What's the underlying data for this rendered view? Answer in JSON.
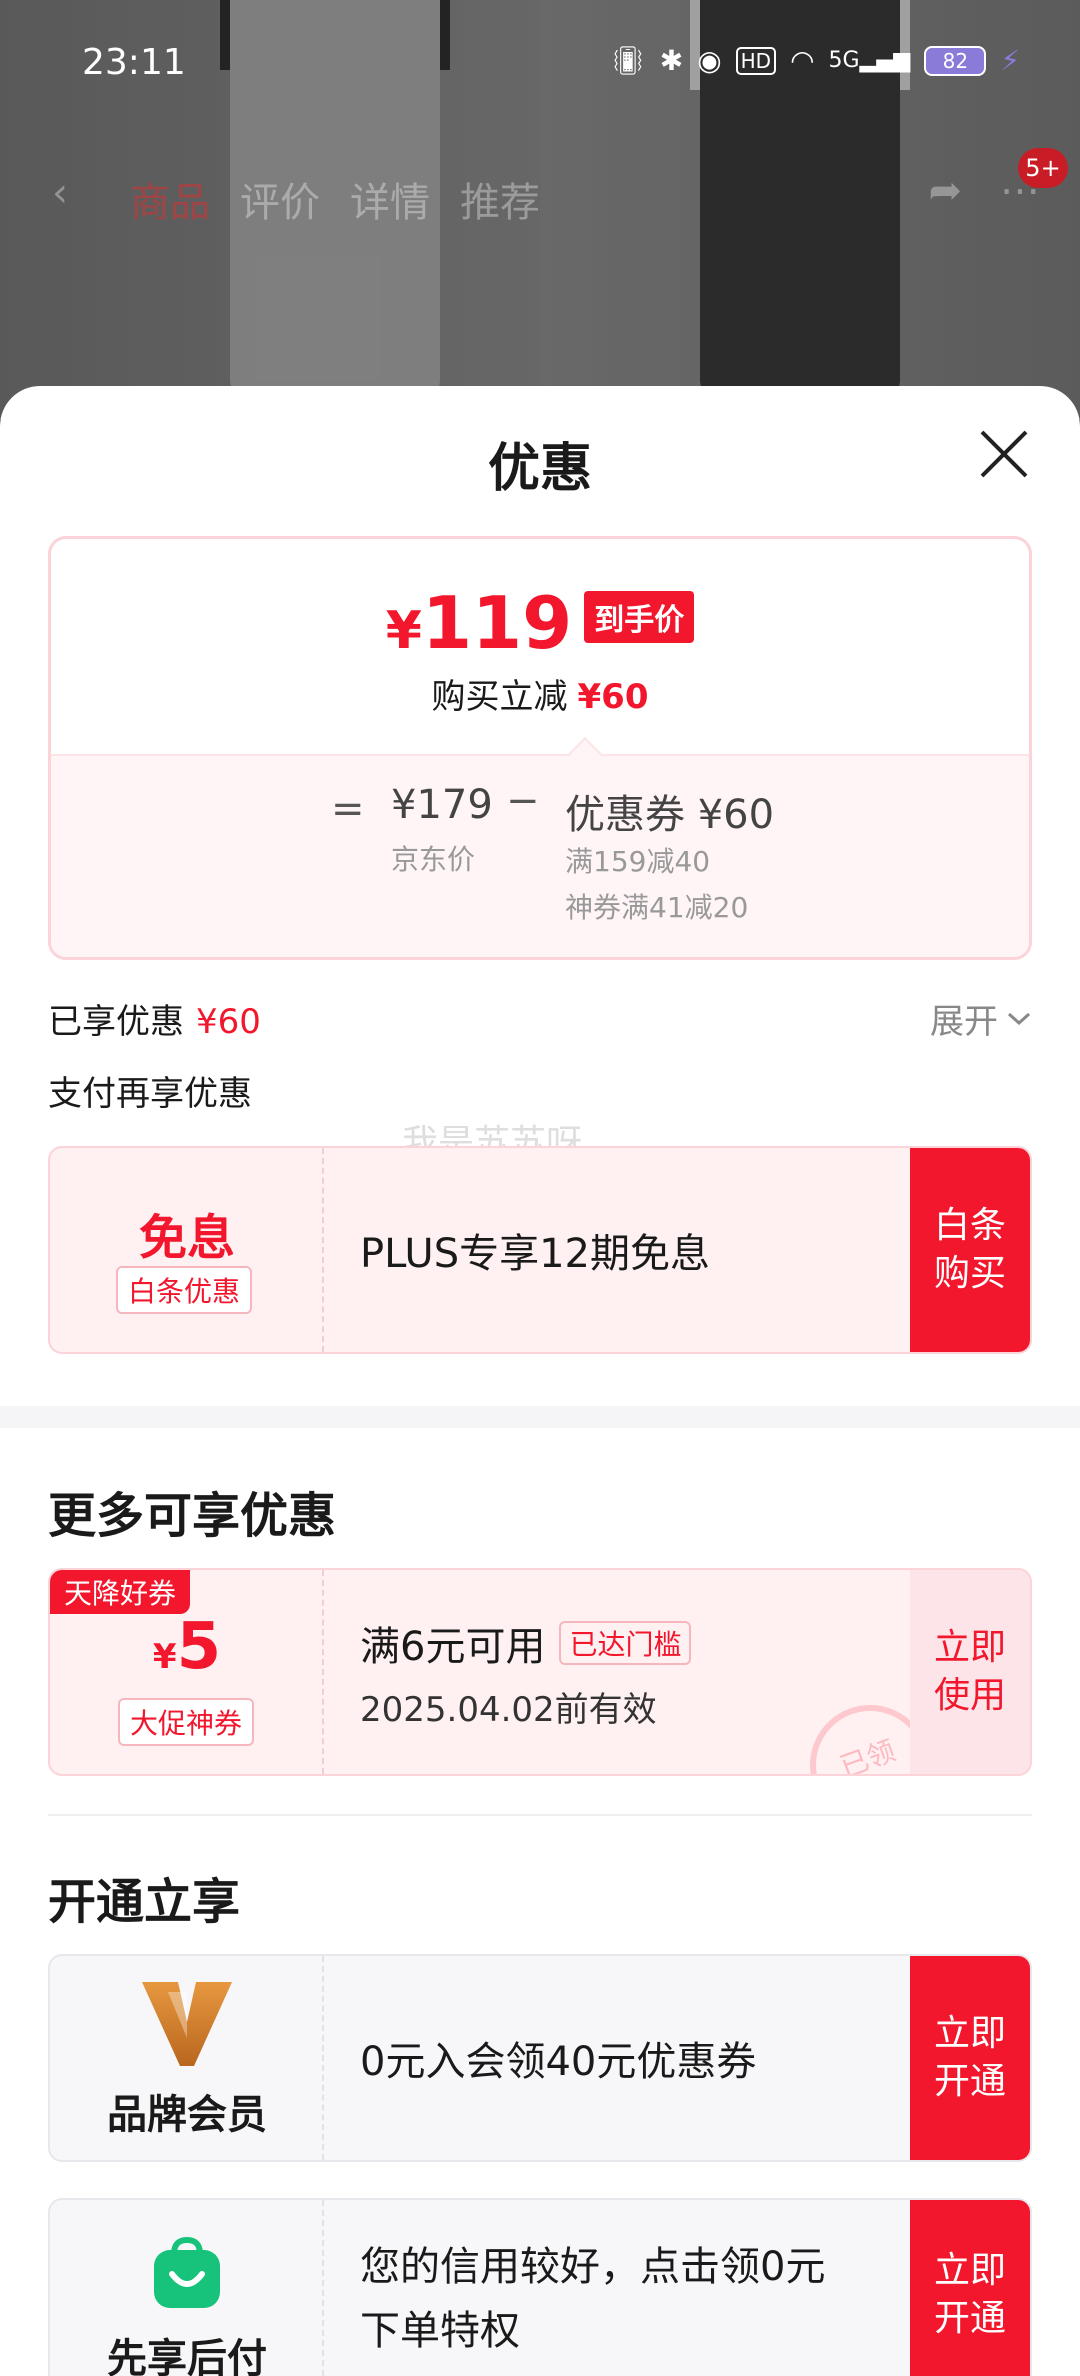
{
  "status_bar": {
    "time": "23:11",
    "battery": "82",
    "network": "5G",
    "hd": "HD"
  },
  "nav": {
    "tabs": [
      "商品",
      "评价",
      "详情",
      "推荐"
    ],
    "cart_badge": "5+"
  },
  "sheet": {
    "title": "优惠"
  },
  "price_card": {
    "currency": "¥",
    "final_price": "119",
    "final_tag": "到手价",
    "reduce_label": "购买立减",
    "reduce_amount": "¥60",
    "equals": "=",
    "jd_price": "¥179",
    "jd_label": "京东价",
    "minus": "−",
    "coupon_total": "优惠券 ¥60",
    "coupon_detail_1": "满159减40",
    "coupon_detail_2": "神券满41减20"
  },
  "enjoyed": {
    "label": "已享优惠",
    "amount": "¥60",
    "expand_label": "展开"
  },
  "pay_more_label": "支付再享优惠",
  "watermark": "我是苏苏呀",
  "baitiao": {
    "title": "免息",
    "tag": "白条优惠",
    "desc": "PLUS专享12期免息",
    "button_line1": "白条",
    "button_line2": "购买"
  },
  "more_section": {
    "title": "更多可享优惠"
  },
  "coupon": {
    "flag": "天降好券",
    "currency": "¥",
    "amount": "5",
    "type": "大促神券",
    "condition": "满6元可用",
    "reached": "已达门槛",
    "valid": "2025.04.02前有效",
    "stamp": "已领",
    "button_line1": "立即",
    "button_line2": "使用"
  },
  "open_section": {
    "title": "开通立享"
  },
  "brand_member": {
    "name": "品牌会员",
    "desc": "0元入会领40元优惠券",
    "button_line1": "立即",
    "button_line2": "开通"
  },
  "pay_later": {
    "name": "先享后付",
    "desc_line1": "您的信用较好，点击领0元",
    "desc_line2": "下单特权",
    "button_line1": "立即",
    "button_line2": "开通"
  }
}
